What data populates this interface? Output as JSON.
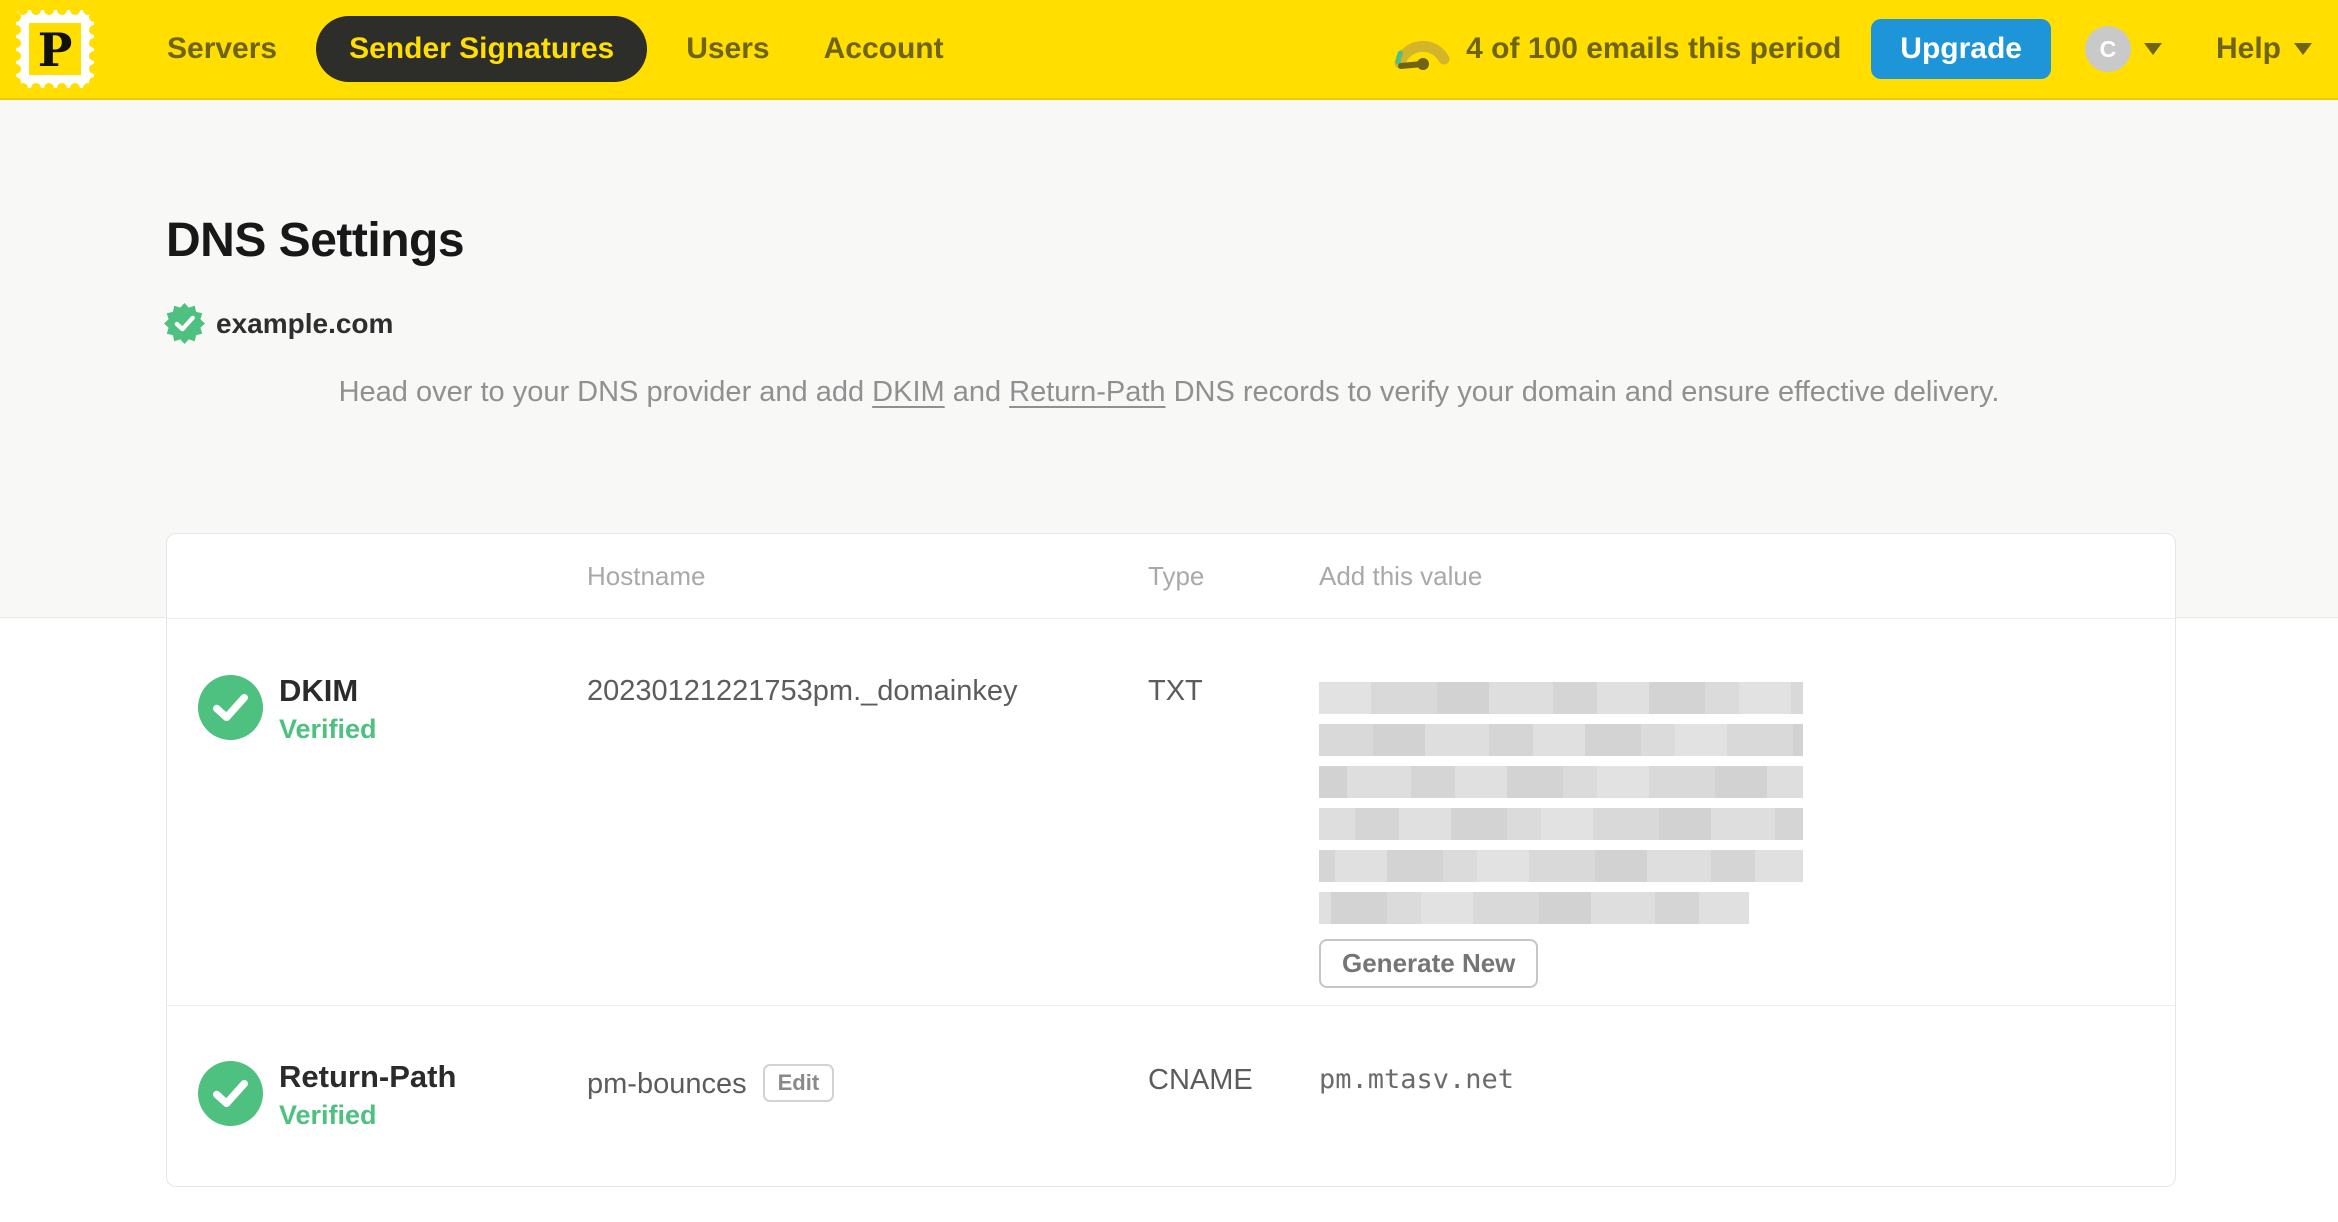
{
  "nav": {
    "logo_letter": "P",
    "items": [
      {
        "label": "Servers",
        "active": false
      },
      {
        "label": "Sender Signatures",
        "active": true
      },
      {
        "label": "Users",
        "active": false
      },
      {
        "label": "Account",
        "active": false
      }
    ],
    "usage_text": "4 of 100 emails this period",
    "upgrade_label": "Upgrade",
    "avatar_initial": "C",
    "help_label": "Help"
  },
  "page": {
    "title": "DNS Settings",
    "domain": "example.com",
    "intro": {
      "prefix": "Head over to your DNS provider and add ",
      "link_dkim": "DKIM",
      "middle": " and ",
      "link_return_path": "Return-Path",
      "suffix": " DNS records to verify your domain and ensure effective delivery."
    }
  },
  "table": {
    "headers": {
      "hostname": "Hostname",
      "type": "Type",
      "value": "Add this value"
    },
    "rows": [
      {
        "name": "DKIM",
        "status": "Verified",
        "hostname": "20230121221753pm._domainkey",
        "type": "TXT",
        "value_redacted": true,
        "redacted_lines": 6,
        "action_label": "Generate New"
      },
      {
        "name": "Return-Path",
        "status": "Verified",
        "hostname": "pm-bounces",
        "hostname_action": "Edit",
        "type": "CNAME",
        "value": "pm.mtasv.net"
      }
    ]
  },
  "colors": {
    "nav_yellow": "#ffde00",
    "nav_active_bg": "#2d2d2a",
    "nav_text": "#6e6414",
    "upgrade_blue": "#1d95d8",
    "verified_green": "#4ec07f",
    "avatar_gray": "#c9c9c9"
  }
}
